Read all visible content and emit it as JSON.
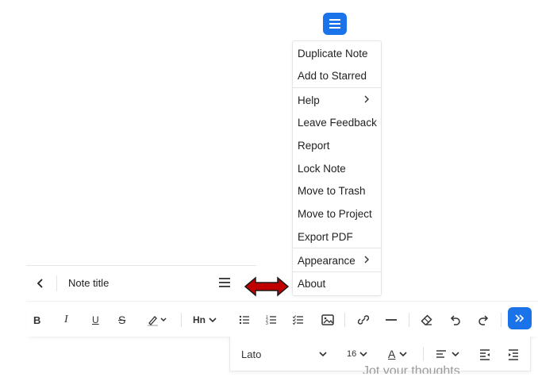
{
  "menu": {
    "items": [
      {
        "label": "Duplicate Note",
        "has_submenu": false
      },
      {
        "label": "Add to Starred",
        "has_submenu": false
      },
      {
        "label": "Help",
        "has_submenu": true
      },
      {
        "label": "Leave Feedback",
        "has_submenu": false
      },
      {
        "label": "Report",
        "has_submenu": false
      },
      {
        "label": "Lock Note",
        "has_submenu": false
      },
      {
        "label": "Move to Trash",
        "has_submenu": false
      },
      {
        "label": "Move to Project",
        "has_submenu": false
      },
      {
        "label": "Export PDF",
        "has_submenu": false
      },
      {
        "label": "Appearance",
        "has_submenu": true
      },
      {
        "label": "About",
        "has_submenu": false
      }
    ]
  },
  "note_header": {
    "title": "Note title"
  },
  "toolbar": {
    "bold": "B",
    "italic": "I",
    "underline": "U",
    "strikethrough": "S",
    "heading": "Hn",
    "icons": [
      "bold-icon",
      "italic-icon",
      "underline-icon",
      "strikethrough-icon",
      "highlight-icon",
      "heading-icon",
      "bullet-list-icon",
      "numbered-list-icon",
      "checklist-icon",
      "image-icon",
      "link-icon",
      "horizontal-rule-icon",
      "eraser-icon",
      "undo-icon",
      "redo-icon",
      "expand-icon"
    ]
  },
  "toolbar2": {
    "font": "Lato",
    "font_size": "16",
    "text_color": "A"
  },
  "editor": {
    "placeholder": "Jot your thoughts"
  },
  "colors": {
    "accent": "#1a73e8",
    "arrow": "#c00000"
  }
}
